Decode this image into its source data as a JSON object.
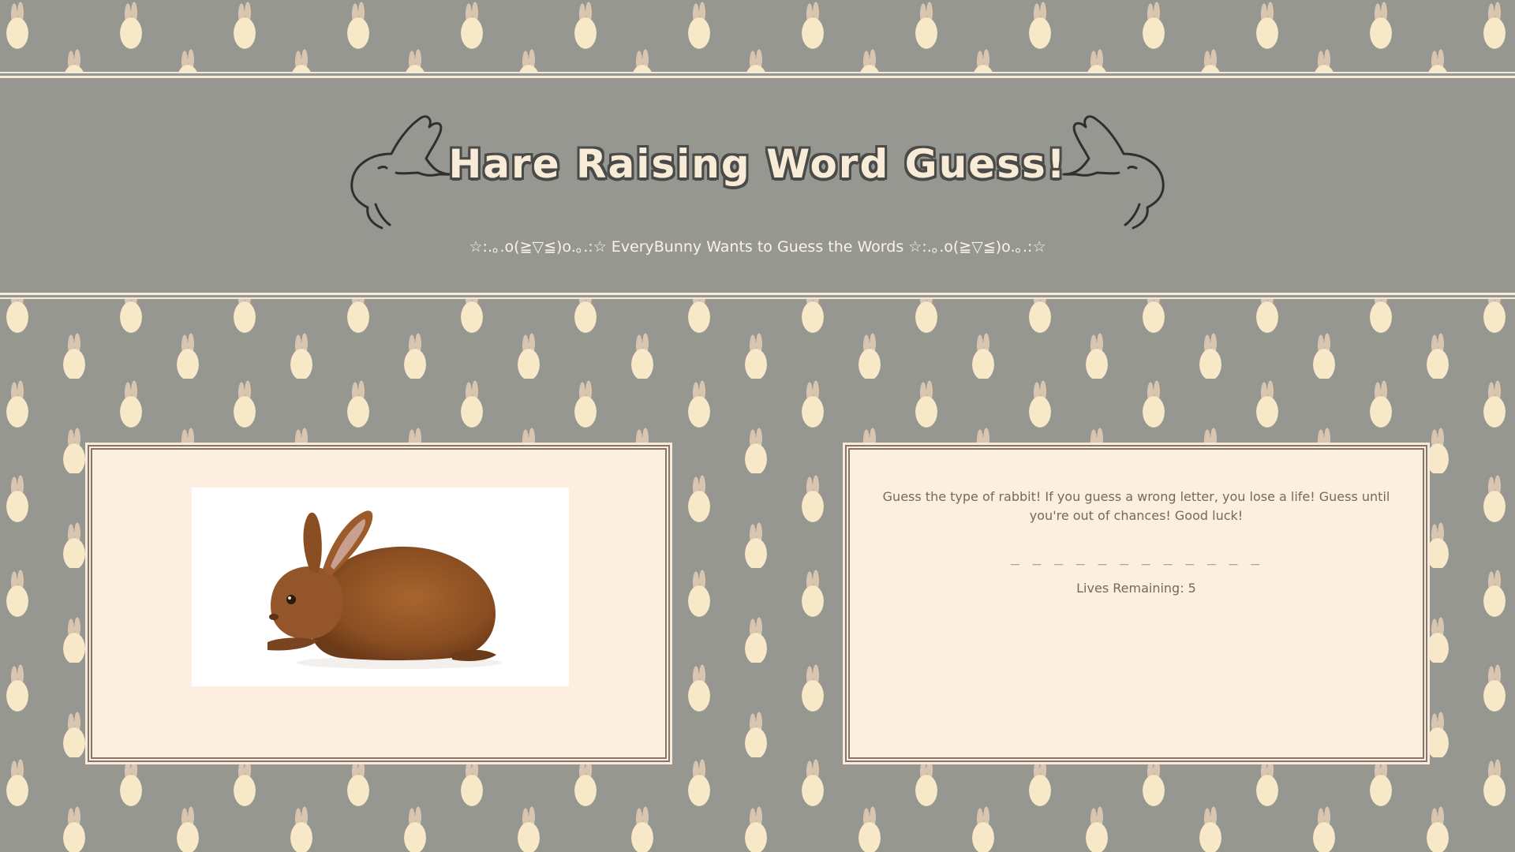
{
  "header": {
    "title": "Hare Raising Word Guess!",
    "subtitle": "☆:.｡.o(≧▽≦)o.｡.:☆ EveryBunny Wants to Guess the Words ☆:.｡.o(≧▽≦)o.｡.:☆"
  },
  "game": {
    "instructions": "Guess the type of rabbit! If you guess a wrong letter, you lose a life! Guess until you're out of chances! Good luck!",
    "word_blanks": "_ _ _ _ _ _ _   _ _ _ _ _",
    "lives_label": "Lives Remaining: 5"
  },
  "icons": {
    "left_bunny": "bunny-outline-icon",
    "right_bunny": "bunny-outline-icon",
    "rabbit_photo": "brown-rabbit-image"
  },
  "colors": {
    "background": "#979792",
    "panel": "#fcefdf",
    "panel_border": "#8a7468",
    "title_fill": "#f8ecd8",
    "title_outline": "#4a4a48",
    "text": "#7a6660"
  }
}
